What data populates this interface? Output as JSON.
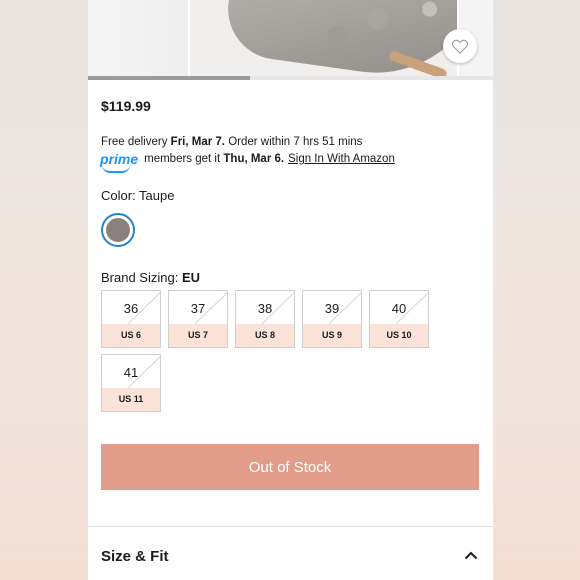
{
  "product": {
    "price": "$119.99",
    "image_progress": 0.4
  },
  "delivery": {
    "line1_prefix": "Free delivery ",
    "line1_date": "Fri, Mar 7.",
    "line1_suffix": " Order within 7 hrs 51 mins",
    "prime_logo": "prime",
    "line2_prefix": "members get it ",
    "line2_date": "Thu, Mar 6.",
    "sign_in_link": "Sign In With Amazon"
  },
  "color": {
    "label": "Color: Taupe",
    "swatch_hex": "#8b817c"
  },
  "sizing": {
    "label_prefix": "Brand Sizing: ",
    "label_system": "EU",
    "sizes": [
      {
        "eu": "36",
        "us": "US 6"
      },
      {
        "eu": "37",
        "us": "US 7"
      },
      {
        "eu": "38",
        "us": "US 8"
      },
      {
        "eu": "39",
        "us": "US 9"
      },
      {
        "eu": "40",
        "us": "US 10"
      },
      {
        "eu": "41",
        "us": "US 11"
      }
    ]
  },
  "cta": {
    "label": "Out of Stock",
    "color": "#e29c8a"
  },
  "section": {
    "title": "Size & Fit"
  },
  "icons": {
    "favorite": "heart-icon",
    "collapse": "chevron-up-icon"
  }
}
